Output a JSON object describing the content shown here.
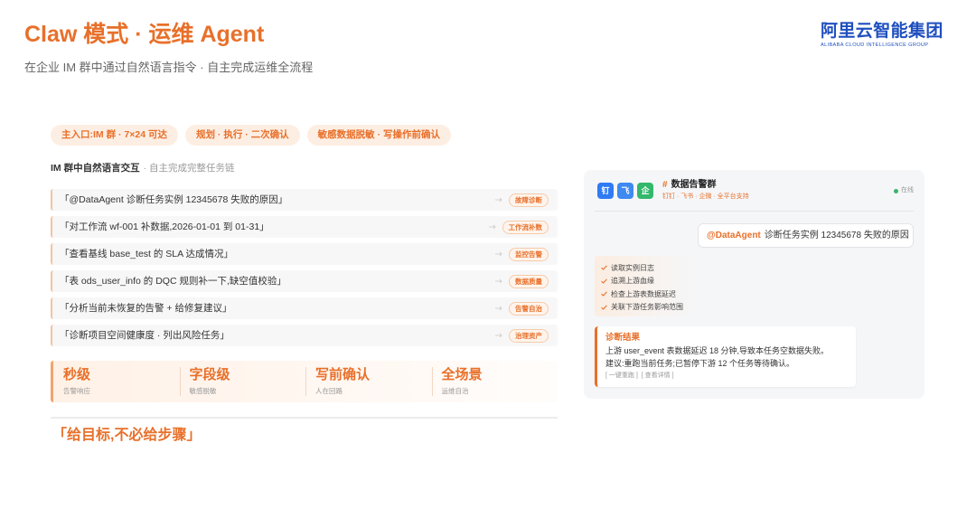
{
  "header": {
    "title": "Claw 模式 · 运维 Agent",
    "subtitle": "在企业 IM 群中通过自然语言指令 · 自主完成运维全流程"
  },
  "logo": {
    "name_cn": "阿里云智能集团",
    "name_en": "ALIBABA CLOUD INTELLIGENCE GROUP"
  },
  "tags": [
    "主入口:IM 群 · 7×24 可达",
    "规划 · 执行 · 二次确认",
    "敏感数据脱敏 · 写操作前确认"
  ],
  "commands": {
    "heading": "IM 群中自然语言交互",
    "heading_sub": "· 自主完成完整任务链",
    "items": [
      {
        "text": "「@DataAgent 诊断任务实例 12345678 失败的原因」",
        "tag": "故障诊断"
      },
      {
        "text": "「对工作流 wf-001 补数据,2026-01-01 到 01-31」",
        "tag": "工作流补数"
      },
      {
        "text": "「查看基线 base_test 的 SLA 达成情况」",
        "tag": "监控告警"
      },
      {
        "text": "「表 ods_user_info 的 DQC 规则补一下,缺空值校验」",
        "tag": "数据质量"
      },
      {
        "text": "「分析当前未恢复的告警 + 给修复建议」",
        "tag": "告警自治"
      },
      {
        "text": "「诊断项目空间健康度 · 列出风险任务」",
        "tag": "治理资产"
      }
    ]
  },
  "stats": [
    {
      "value": "秒级",
      "label": "告警响应"
    },
    {
      "value": "字段级",
      "label": "敏感脱敏"
    },
    {
      "value": "写前确认",
      "label": "人在回路"
    },
    {
      "value": "全场景",
      "label": "运维自治"
    }
  ],
  "quote": "「给目标,不必给步骤」",
  "chat": {
    "apps": [
      "钉",
      "飞",
      "企"
    ],
    "group_hash": "#",
    "group_name": "数据告警群",
    "platforms": "钉钉 · 飞书 · 企微 · 全平台支持",
    "status": "在线",
    "message": {
      "mention": "@DataAgent",
      "text": "诊断任务实例 12345678 失败的原因"
    },
    "steps": [
      "读取实例日志",
      "追溯上游血缘",
      "检查上游表数据延迟",
      "关联下游任务影响范围"
    ],
    "result": {
      "title": "诊断结果",
      "lines": [
        "上游 user_event 表数据延迟 18 分钟,导致本任务空数据失败。",
        "建议:重跑当前任务;已暂停下游 12 个任务等待确认。"
      ],
      "actions": [
        "[ 一键重跑 ]",
        "[ 查看详情 ]"
      ]
    }
  },
  "icons": {
    "row_arrow": "arrow-right-icon",
    "step_check": "check-icon",
    "status": "online-dot-icon",
    "apps": [
      "dingtalk-icon",
      "feishu-icon",
      "wecom-icon"
    ]
  },
  "colors": {
    "accent": "#E8702A",
    "accent_light": "#FDEEE3",
    "logo_blue": "#1F4FBF",
    "online_green": "#3BB36A",
    "dingtalk_blue": "#2F7BF5",
    "feishu_blue": "#3E8AF1",
    "wecom_green": "#33B86C"
  }
}
